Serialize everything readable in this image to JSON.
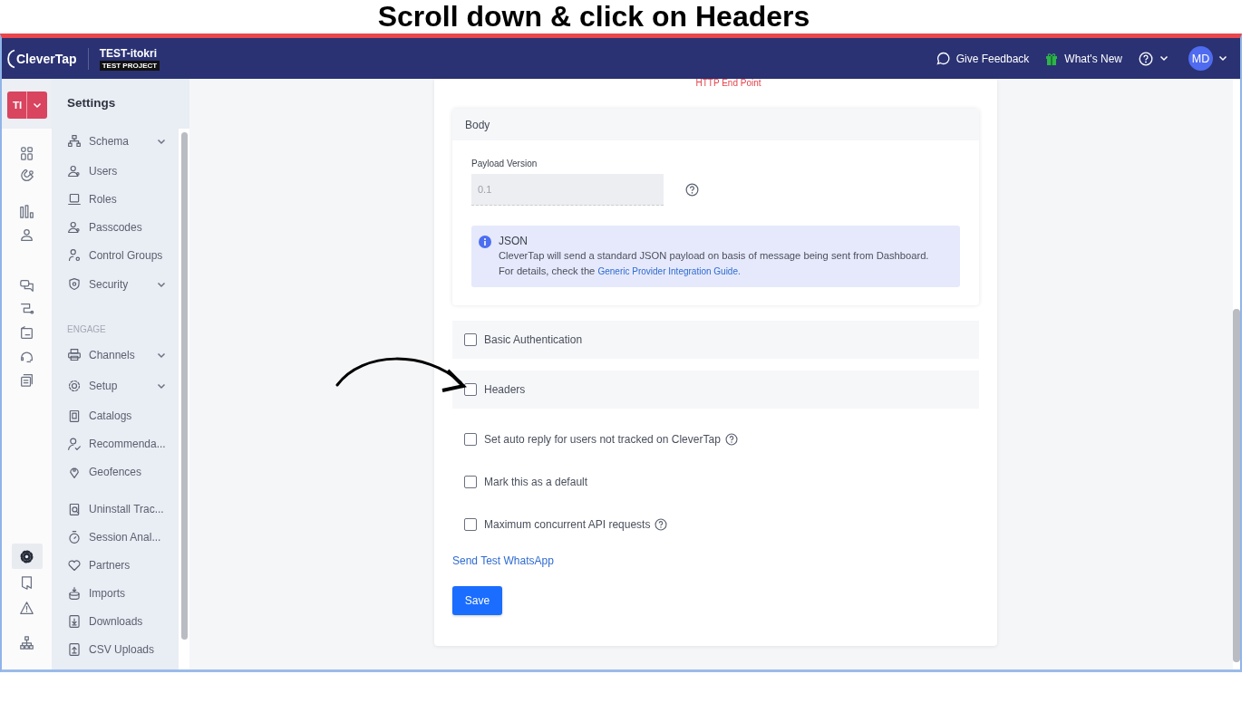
{
  "caption": "Scroll down & click on Headers",
  "header": {
    "logo": "CleverTap",
    "project": "TEST-itokri",
    "badge": "TEST PROJECT",
    "actions": [
      {
        "kind": "feedback",
        "label": "Give Feedback"
      },
      {
        "kind": "whatsnew",
        "label": "What's New"
      },
      {
        "kind": "help"
      }
    ],
    "avatar": "MD"
  },
  "workspace": "TI",
  "rail": [
    {
      "selected": false
    },
    {
      "selected": false
    },
    {
      "selected": false
    },
    {
      "selected": false
    },
    {
      "selected": false
    },
    {
      "selected": false
    },
    {
      "selected": false
    },
    {
      "selected": false
    },
    {
      "selected": false
    },
    {
      "selected": true
    },
    {
      "selected": false
    },
    {
      "selected": false
    },
    {
      "selected": false
    }
  ],
  "settings": {
    "title": "Settings",
    "groups": [
      {
        "items": [
          {
            "label": "Schema",
            "submenu": true
          },
          {
            "label": "Users"
          },
          {
            "label": "Roles"
          },
          {
            "label": "Passcodes"
          },
          {
            "label": "Control Groups"
          },
          {
            "label": "Security",
            "submenu": true
          }
        ]
      },
      {
        "heading": "ENGAGE",
        "items": [
          {
            "label": "Channels",
            "submenu": true
          },
          {
            "label": "Setup",
            "submenu": true
          },
          {
            "label": "Catalogs"
          },
          {
            "label": "Recommenda..."
          },
          {
            "label": "Geofences"
          }
        ]
      },
      {
        "items": [
          {
            "label": "Uninstall Trac..."
          },
          {
            "label": "Session Anal..."
          },
          {
            "label": "Partners"
          },
          {
            "label": "Imports"
          },
          {
            "label": "Downloads"
          },
          {
            "label": "CSV Uploads"
          }
        ]
      }
    ]
  },
  "form": {
    "endpoint_error": "HTTP End Point",
    "body": {
      "title": "Body",
      "payload_label": "Payload Version",
      "payload_value": "0.1",
      "payload_disabled": true,
      "info": {
        "title": "JSON",
        "text": "CleverTap will send a standard JSON payload on basis of message being sent from Dashboard.",
        "details": "For details, check the",
        "link": "Generic Provider Integration Guide."
      }
    },
    "options": [
      {
        "label": "Basic Authentication",
        "checked": false,
        "panel": true
      },
      {
        "label": "Headers",
        "checked": false,
        "panel": true
      },
      {
        "label": "Set auto reply for users not tracked on CleverTap",
        "checked": false,
        "help": true
      },
      {
        "label": "Mark this as a default",
        "checked": false
      },
      {
        "label": "Maximum concurrent API requests",
        "checked": false,
        "help": true
      }
    ],
    "link": "Send Test WhatsApp",
    "save": "Save"
  }
}
